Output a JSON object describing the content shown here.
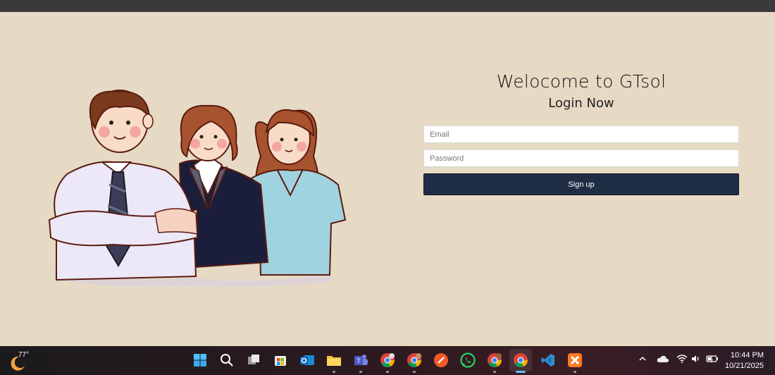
{
  "login": {
    "title": "Welocome to GTsol",
    "subtitle": "Login Now",
    "email_placeholder": "Email",
    "password_placeholder": "Password",
    "signup_label": "Sign up",
    "button_color": "#1f2d44"
  },
  "taskbar": {
    "weather_temp": "77°",
    "time": "10:44 PM",
    "date": "10/21/2025",
    "apps": [
      "windows-start-icon",
      "search-icon",
      "task-view-icon",
      "store-icon",
      "outlook-icon",
      "file-explorer-icon",
      "teams-icon",
      "chrome-profile-icon",
      "chrome-profile-2-icon",
      "brave-icon",
      "whatsapp-icon",
      "chrome-profile-3-icon",
      "chrome-icon",
      "vscode-icon",
      "xampp-icon"
    ]
  },
  "colors": {
    "background": "#e6dac4",
    "top_strip": "#3a3a3c"
  }
}
